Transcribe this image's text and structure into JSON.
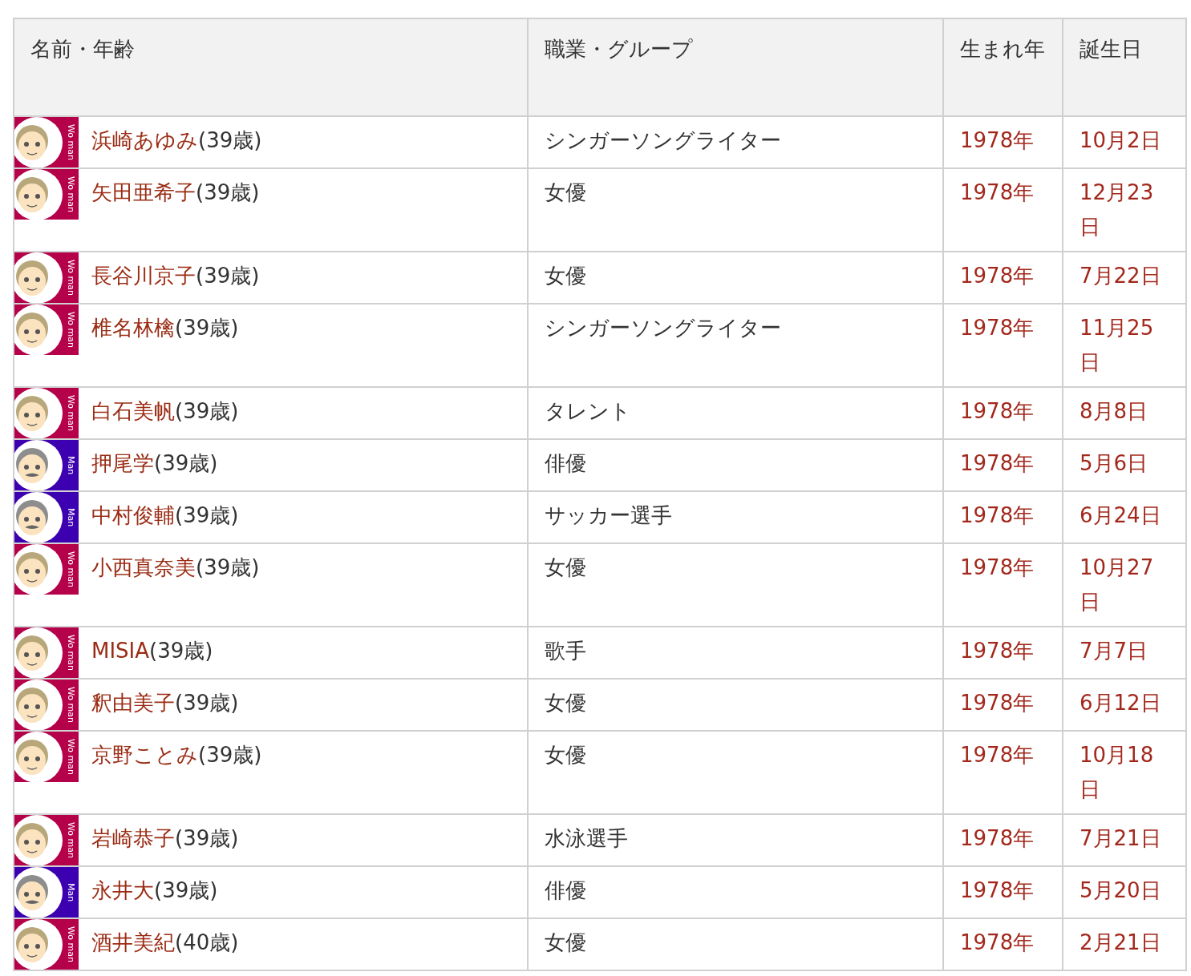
{
  "table": {
    "columns": [
      "名前・年齢",
      "職業・グループ",
      "生まれ年",
      "誕生日"
    ],
    "rows": [
      {
        "kind": "woman",
        "badge": "Wo man",
        "name": "浜崎あゆみ",
        "age": "(39歳)",
        "job": "シンガーソングライター",
        "year": "1978年",
        "birthday": "10月2日"
      },
      {
        "kind": "woman",
        "badge": "Wo man",
        "name": "矢田亜希子",
        "age": "(39歳)",
        "job": "女優",
        "year": "1978年",
        "birthday": "12月23日"
      },
      {
        "kind": "woman",
        "badge": "Wo man",
        "name": "長谷川京子",
        "age": "(39歳)",
        "job": "女優",
        "year": "1978年",
        "birthday": "7月22日"
      },
      {
        "kind": "woman",
        "badge": "Wo man",
        "name": "椎名林檎",
        "age": "(39歳)",
        "job": "シンガーソングライター",
        "year": "1978年",
        "birthday": "11月25日"
      },
      {
        "kind": "woman",
        "badge": "Wo man",
        "name": "白石美帆",
        "age": "(39歳)",
        "job": "タレント",
        "year": "1978年",
        "birthday": "8月8日"
      },
      {
        "kind": "man",
        "badge": "Man",
        "name": "押尾学",
        "age": "(39歳)",
        "job": "俳優",
        "year": "1978年",
        "birthday": "5月6日"
      },
      {
        "kind": "man",
        "badge": "Man",
        "name": "中村俊輔",
        "age": "(39歳)",
        "job": "サッカー選手",
        "year": "1978年",
        "birthday": "6月24日"
      },
      {
        "kind": "woman",
        "badge": "Wo man",
        "name": "小西真奈美",
        "age": "(39歳)",
        "job": "女優",
        "year": "1978年",
        "birthday": "10月27日"
      },
      {
        "kind": "woman",
        "badge": "Wo man",
        "name": "MISIA",
        "age": "(39歳)",
        "job": "歌手",
        "year": "1978年",
        "birthday": "7月7日"
      },
      {
        "kind": "woman",
        "badge": "Wo man",
        "name": "釈由美子",
        "age": "(39歳)",
        "job": "女優",
        "year": "1978年",
        "birthday": "6月12日"
      },
      {
        "kind": "woman",
        "badge": "Wo man",
        "name": "京野ことみ",
        "age": "(39歳)",
        "job": "女優",
        "year": "1978年",
        "birthday": "10月18日"
      },
      {
        "kind": "woman",
        "badge": "Wo man",
        "name": "岩崎恭子",
        "age": "(39歳)",
        "job": "水泳選手",
        "year": "1978年",
        "birthday": "7月21日"
      },
      {
        "kind": "man",
        "badge": "Man",
        "name": "永井大",
        "age": "(39歳)",
        "job": "俳優",
        "year": "1978年",
        "birthday": "5月20日"
      },
      {
        "kind": "woman",
        "badge": "Wo man",
        "name": "酒井美紀",
        "age": "(40歳)",
        "job": "女優",
        "year": "1978年",
        "birthday": "2月21日"
      }
    ]
  }
}
